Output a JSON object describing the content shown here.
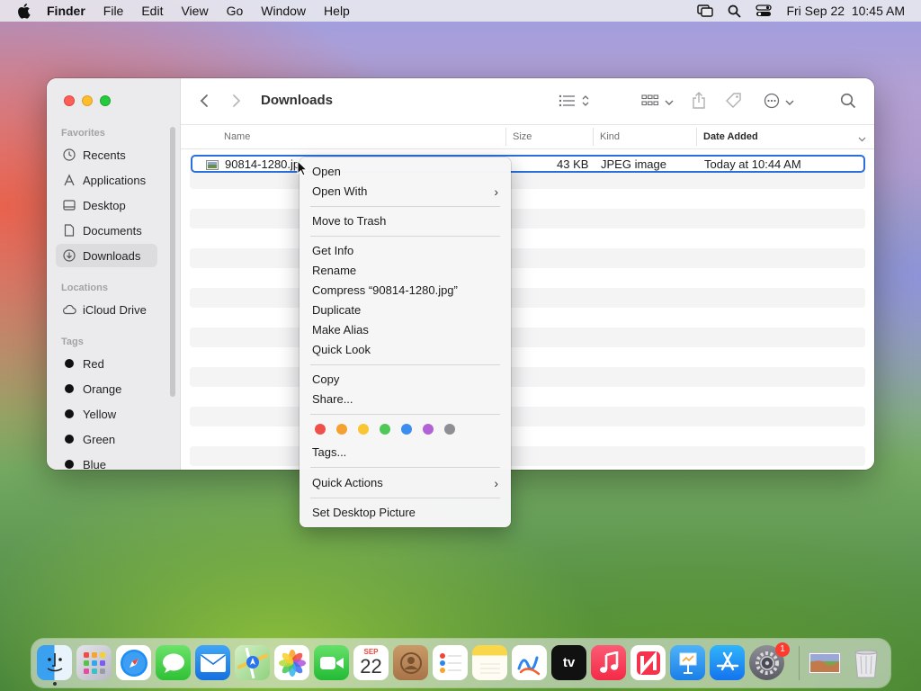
{
  "menubar": {
    "app": "Finder",
    "items": [
      "File",
      "Edit",
      "View",
      "Go",
      "Window",
      "Help"
    ],
    "datetime": "Fri Sep 22  10:45 AM"
  },
  "window": {
    "title": "Downloads"
  },
  "sidebar": {
    "favorites_label": "Favorites",
    "favorites": [
      "Recents",
      "Applications",
      "Desktop",
      "Documents",
      "Downloads"
    ],
    "locations_label": "Locations",
    "locations": [
      "iCloud Drive"
    ],
    "tags_label": "Tags",
    "tags": [
      {
        "name": "Red",
        "color": "#111"
      },
      {
        "name": "Orange",
        "color": "#111"
      },
      {
        "name": "Yellow",
        "color": "#111"
      },
      {
        "name": "Green",
        "color": "#111"
      },
      {
        "name": "Blue",
        "color": "#111"
      }
    ]
  },
  "columns": {
    "name": "Name",
    "size": "Size",
    "kind": "Kind",
    "date": "Date Added"
  },
  "file": {
    "name": "90814-1280.jp",
    "size": "43 KB",
    "kind": "JPEG image",
    "date": "Today at 10:44 AM"
  },
  "context_menu": {
    "open": "Open",
    "open_with": "Open With",
    "trash": "Move to Trash",
    "get_info": "Get Info",
    "rename": "Rename",
    "compress": "Compress “90814-1280.jpg”",
    "duplicate": "Duplicate",
    "alias": "Make Alias",
    "quick_look": "Quick Look",
    "copy": "Copy",
    "share": "Share...",
    "tags": "Tags...",
    "quick_actions": "Quick Actions",
    "desktop_picture": "Set Desktop Picture",
    "tag_colors": [
      "#f0504a",
      "#f5a033",
      "#f7c631",
      "#4fc85a",
      "#3b8df0",
      "#b262d6",
      "#8e8e93"
    ]
  },
  "dock": {
    "calendar_month": "SEP",
    "calendar_day": "22",
    "settings_badge": "1",
    "tv_label": "tv"
  }
}
